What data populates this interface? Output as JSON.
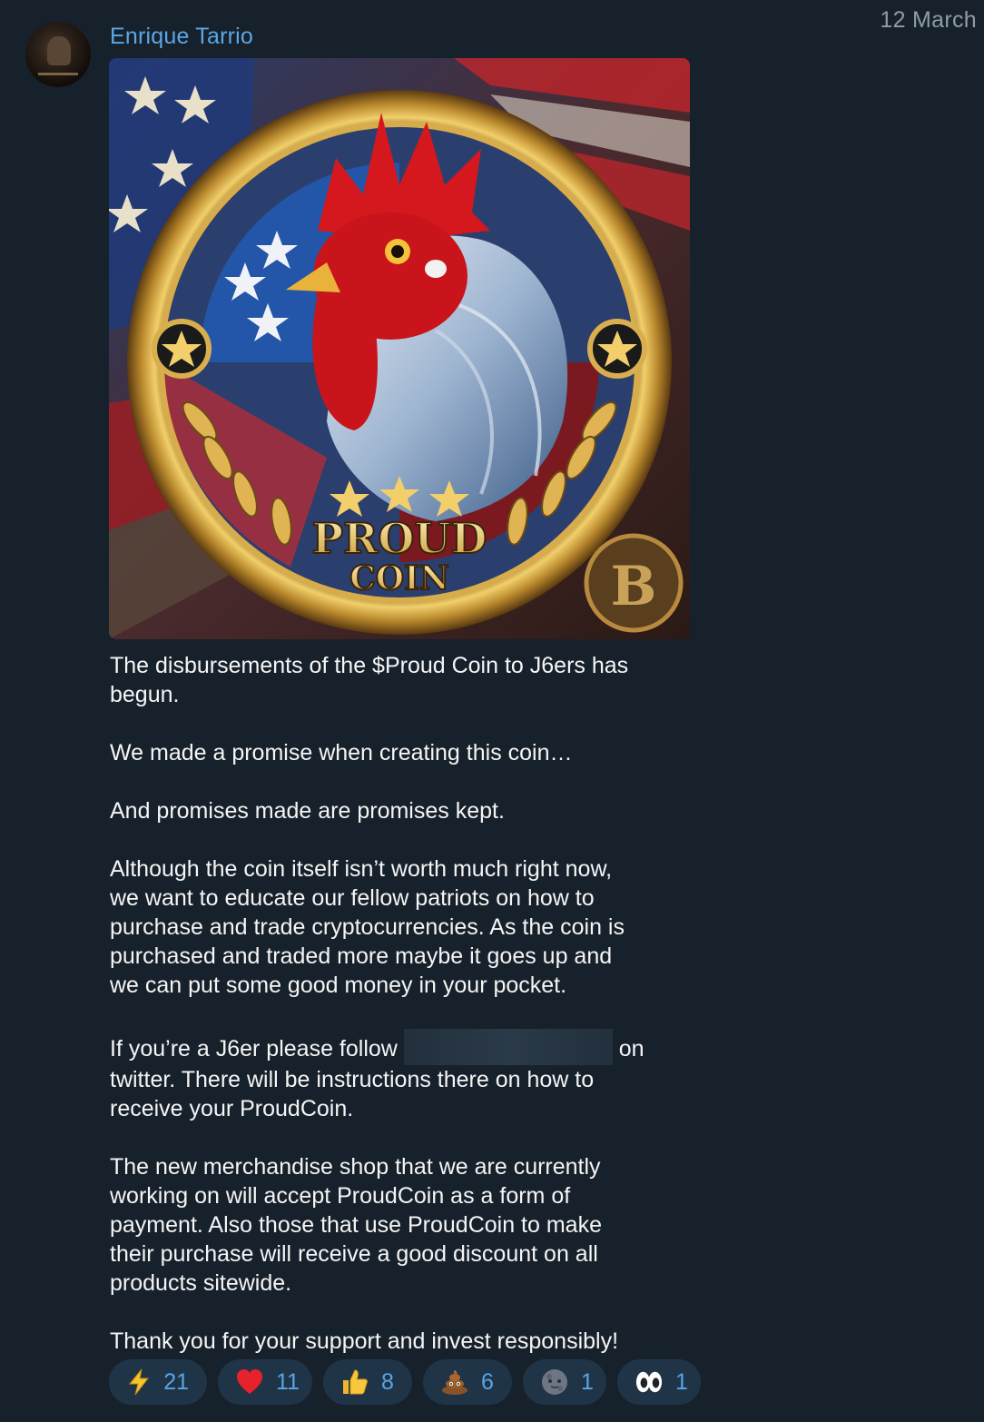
{
  "message": {
    "date": "12 March",
    "sender": "Enrique Tarrio",
    "photo": {
      "coin_text_line1": "PROUD",
      "coin_text_line2": "COIN",
      "badge_letter": "B"
    },
    "paragraphs": [
      "The disbursements of the $Proud Coin to J6ers has\nbegun.",
      "We made a promise when creating this coin…",
      "And promises made are promises kept.",
      "Although the coin itself isn’t worth much right now,\nwe want to educate our fellow patriots on how to\npurchase and trade cryptocurrencies. As the coin is\npurchased and traded more maybe it goes up and\nwe can put some good money in your pocket.",
      "The new merchandise shop that we are currently\nworking on will accept ProudCoin as a form of\npayment. Also those that use ProudCoin to make\ntheir purchase will receive a good discount on all\nproducts sitewide.",
      "Thank you for your support and invest responsibly!"
    ],
    "follow_paragraph": {
      "before": "If you’re a J6er please follow",
      "after": "on",
      "rest": "twitter. There will be instructions there on how to\nreceive your ProudCoin."
    }
  },
  "reactions": [
    {
      "icon": "lightning-icon",
      "count": "21"
    },
    {
      "icon": "heart-icon",
      "count": "11"
    },
    {
      "icon": "thumbs-up-icon",
      "count": "8"
    },
    {
      "icon": "poop-icon",
      "count": "6"
    },
    {
      "icon": "new-moon-face-icon",
      "count": "1"
    },
    {
      "icon": "eyes-icon",
      "count": "1"
    }
  ],
  "colors": {
    "background": "#17212b",
    "sender": "#5aa7e8",
    "reaction_bg": "#203447",
    "reaction_count": "#57a5e8"
  }
}
